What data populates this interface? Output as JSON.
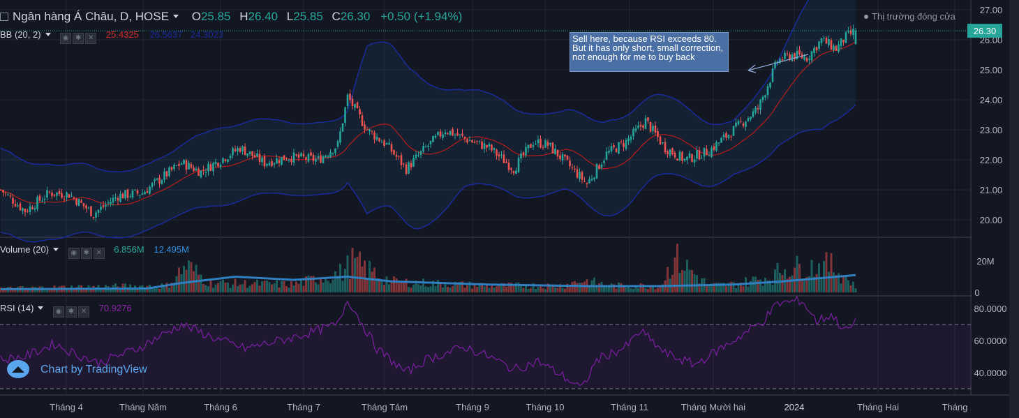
{
  "header": {
    "title": "Ngân hàng Á Châu, D, HOSE",
    "o_label": "O",
    "o_value": "25.85",
    "h_label": "H",
    "h_value": "26.40",
    "l_label": "L",
    "l_value": "25.85",
    "c_label": "C",
    "c_value": "26.30",
    "change": "+0.50 (+1.94%)"
  },
  "market_status": "Thị trường đóng cửa",
  "indicators": {
    "bb": {
      "label": "BB (20, 2)",
      "basis": "25.4325",
      "upper": "26.5637",
      "lower": "24.3023"
    },
    "volume": {
      "label": "Volume (20)",
      "value": "6.856M",
      "ma": "12.495M"
    },
    "rsi": {
      "label": "RSI (14)",
      "value": "70.9276"
    }
  },
  "annotation": "Sell here, because RSI exceeds 80. But it has only short, small correction, not enough for me to buy back",
  "brand": "Chart by TradingView",
  "colors": {
    "up": "#26a69a",
    "down": "#ef5350",
    "bb_band": "#1a237e",
    "bb_basis": "#b71c1c",
    "volume_ma": "#2f7fc1",
    "rsi": "#7b1fa2",
    "background": "#131722"
  },
  "chart_data": {
    "type": "candlestick",
    "price_axis": {
      "ticks": [
        "27.00",
        "26.00",
        "25.00",
        "24.00",
        "23.00",
        "22.00",
        "21.00",
        "20.00"
      ],
      "ylim": [
        19.8,
        27.0
      ],
      "last_price_label": "26.30"
    },
    "volume_axis": {
      "ticks": [
        "20M",
        "0"
      ],
      "ylim": [
        0,
        30
      ]
    },
    "rsi_axis": {
      "ticks": [
        "80.0000",
        "60.0000",
        "40.0000"
      ],
      "ylim": [
        24,
        91
      ],
      "bands": [
        70,
        30
      ]
    },
    "x_tick_labels": [
      "Tháng 4",
      "Tháng Năm",
      "Tháng 6",
      "Tháng 7",
      "Tháng Tám",
      "Tháng 9",
      "Tháng 10",
      "Tháng 11",
      "Tháng Mười hai",
      "2024",
      "Tháng Hai",
      "Tháng"
    ],
    "close_keypoints": [
      [
        0,
        21.0
      ],
      [
        10,
        20.3
      ],
      [
        20,
        20.9
      ],
      [
        28,
        20.85
      ],
      [
        38,
        20.2
      ],
      [
        48,
        20.8
      ],
      [
        58,
        20.9
      ],
      [
        66,
        21.4
      ],
      [
        74,
        21.9
      ],
      [
        82,
        21.6
      ],
      [
        90,
        22.0
      ],
      [
        98,
        22.4
      ],
      [
        108,
        21.9
      ],
      [
        118,
        22.1
      ],
      [
        130,
        22.0
      ],
      [
        138,
        22.5
      ],
      [
        142,
        24.1
      ],
      [
        150,
        23.0
      ],
      [
        158,
        22.5
      ],
      [
        166,
        21.7
      ],
      [
        174,
        22.4
      ],
      [
        182,
        23.0
      ],
      [
        190,
        22.7
      ],
      [
        200,
        22.4
      ],
      [
        210,
        21.7
      ],
      [
        218,
        22.6
      ],
      [
        224,
        22.5
      ],
      [
        234,
        21.7
      ],
      [
        240,
        21.2
      ],
      [
        248,
        22.2
      ],
      [
        256,
        22.6
      ],
      [
        264,
        23.3
      ],
      [
        272,
        22.4
      ],
      [
        280,
        22.0
      ],
      [
        290,
        22.3
      ],
      [
        300,
        23.0
      ],
      [
        310,
        23.7
      ],
      [
        318,
        25.3
      ],
      [
        324,
        25.5
      ],
      [
        330,
        25.4
      ],
      [
        336,
        26.0
      ],
      [
        342,
        25.7
      ],
      [
        346,
        26.1
      ],
      [
        350,
        26.3
      ]
    ],
    "volume_keypoints": [
      [
        0,
        3
      ],
      [
        30,
        4
      ],
      [
        68,
        5
      ],
      [
        76,
        20
      ],
      [
        86,
        7
      ],
      [
        120,
        6
      ],
      [
        140,
        15
      ],
      [
        144,
        23
      ],
      [
        160,
        8
      ],
      [
        200,
        5
      ],
      [
        230,
        5
      ],
      [
        238,
        9
      ],
      [
        250,
        5
      ],
      [
        270,
        5
      ],
      [
        276,
        26
      ],
      [
        290,
        5
      ],
      [
        300,
        6
      ],
      [
        316,
        12
      ],
      [
        320,
        18
      ],
      [
        340,
        20
      ],
      [
        350,
        5
      ]
    ],
    "volume_ma_keypoints": [
      [
        0,
        2
      ],
      [
        60,
        2.5
      ],
      [
        74,
        6
      ],
      [
        96,
        10
      ],
      [
        120,
        8
      ],
      [
        142,
        10
      ],
      [
        160,
        7
      ],
      [
        200,
        5
      ],
      [
        240,
        4
      ],
      [
        270,
        4
      ],
      [
        300,
        5
      ],
      [
        320,
        7
      ],
      [
        350,
        11
      ]
    ],
    "rsi_keypoints": [
      [
        0,
        48
      ],
      [
        10,
        50
      ],
      [
        22,
        58
      ],
      [
        30,
        52
      ],
      [
        40,
        46
      ],
      [
        56,
        55
      ],
      [
        74,
        70
      ],
      [
        90,
        60
      ],
      [
        100,
        55
      ],
      [
        120,
        62
      ],
      [
        138,
        70
      ],
      [
        142,
        86
      ],
      [
        154,
        55
      ],
      [
        166,
        40
      ],
      [
        174,
        48
      ],
      [
        190,
        56
      ],
      [
        200,
        50
      ],
      [
        210,
        42
      ],
      [
        220,
        47
      ],
      [
        230,
        38
      ],
      [
        238,
        30
      ],
      [
        244,
        48
      ],
      [
        256,
        56
      ],
      [
        262,
        66
      ],
      [
        272,
        52
      ],
      [
        284,
        45
      ],
      [
        300,
        60
      ],
      [
        312,
        72
      ],
      [
        318,
        83
      ],
      [
        328,
        85
      ],
      [
        334,
        72
      ],
      [
        340,
        76
      ],
      [
        346,
        66
      ],
      [
        350,
        71
      ]
    ],
    "bb_width_keypoints": [
      [
        0,
        1.4
      ],
      [
        40,
        1.1
      ],
      [
        70,
        1.1
      ],
      [
        90,
        1.3
      ],
      [
        120,
        1.2
      ],
      [
        142,
        1.2
      ],
      [
        150,
        2.8
      ],
      [
        170,
        2.6
      ],
      [
        190,
        1.6
      ],
      [
        230,
        1.3
      ],
      [
        250,
        1.6
      ],
      [
        280,
        1.2
      ],
      [
        300,
        0.9
      ],
      [
        318,
        1.4
      ],
      [
        336,
        2.5
      ],
      [
        350,
        2.1
      ]
    ]
  }
}
